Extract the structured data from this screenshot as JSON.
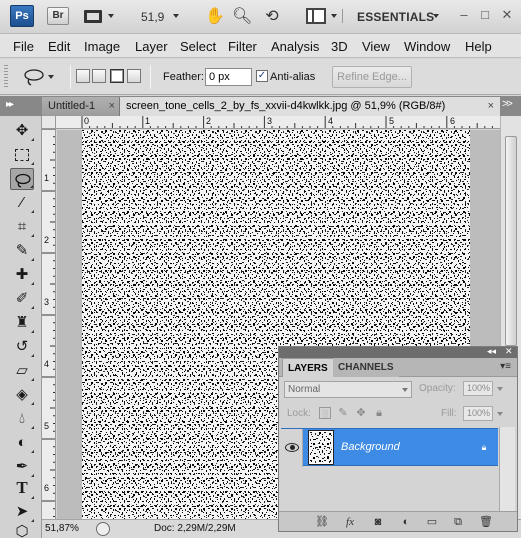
{
  "app": {
    "logo": "Ps",
    "bridge": "Br",
    "zoom": "51,9",
    "workspace": "ESSENTIALS",
    "window_buttons": [
      "–",
      "□",
      "✕"
    ]
  },
  "menu": [
    "File",
    "Edit",
    "Image",
    "Layer",
    "Select",
    "Filter",
    "Analysis",
    "3D",
    "View",
    "Window",
    "Help"
  ],
  "options": {
    "feather_label": "Feather:",
    "feather_value": "0 px",
    "antialias_label": "Anti-alias",
    "antialias_checked": true,
    "refine_label": "Refine Edge..."
  },
  "tabs": {
    "inactive": "Untitled-1",
    "active": "screen_tone_cells_2_by_fs_xxvii-d4kwlkk.jpg @ 51,9% (RGB/8#)",
    "close": "×",
    "more": ">>"
  },
  "rulers": {
    "h_labels": [
      "0",
      "1",
      "2",
      "3",
      "4",
      "5",
      "6"
    ],
    "v_labels": [
      "1",
      "2",
      "3",
      "4",
      "5",
      "6"
    ]
  },
  "status": {
    "zoom": "51,87%",
    "doc": "Doc: 2,29M/2,29M"
  },
  "layers_panel": {
    "tabs": [
      "LAYERS",
      "CHANNELS"
    ],
    "blend_mode": "Normal",
    "opacity_label": "Opacity:",
    "opacity_value": "100%",
    "lock_label": "Lock:",
    "fill_label": "Fill:",
    "fill_value": "100%",
    "layer_name": "Background"
  },
  "colors": {
    "selection_blue": "#3e8be5",
    "tab_strip": "#888888",
    "canvas_bg": "#bcbcbc"
  },
  "icons": {
    "tools": [
      "move-tool-icon",
      "marquee-tool-icon",
      "lasso-tool-icon",
      "magic-wand-icon",
      "crop-tool-icon",
      "eyedropper-icon",
      "healing-brush-icon",
      "brush-tool-icon",
      "clone-stamp-icon",
      "history-brush-icon",
      "eraser-icon",
      "paint-bucket-icon",
      "blur-tool-icon",
      "dodge-tool-icon",
      "pen-tool-icon",
      "type-tool-icon",
      "path-selection-icon",
      "shape-tool-icon"
    ],
    "footer": [
      "link-layers-icon",
      "fx-icon",
      "mask-icon",
      "adjustment-icon",
      "group-icon",
      "new-layer-icon",
      "trash-icon"
    ]
  }
}
